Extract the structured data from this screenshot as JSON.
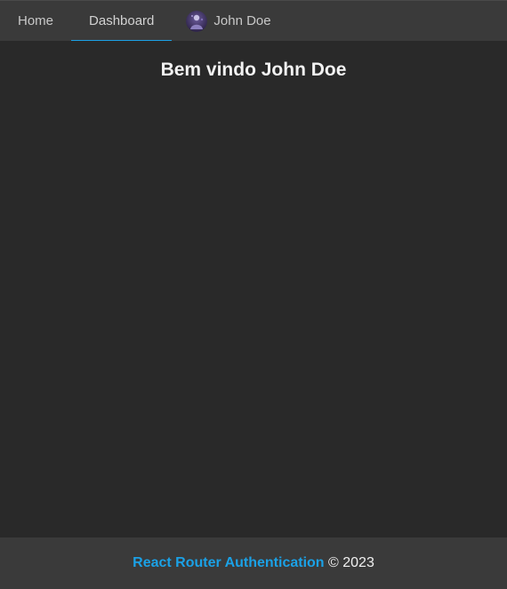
{
  "nav": {
    "tabs": [
      {
        "label": "Home",
        "active": false
      },
      {
        "label": "Dashboard",
        "active": true
      }
    ],
    "user": {
      "name": "John Doe",
      "avatar_icon": "user-avatar-image"
    }
  },
  "main": {
    "title": "Bem vindo John Doe"
  },
  "footer": {
    "link_text": "React Router Authentication",
    "copyright": "© 2023"
  },
  "colors": {
    "accent": "#1ba1e6",
    "background": "#292929",
    "bar": "#3a3a3a"
  }
}
